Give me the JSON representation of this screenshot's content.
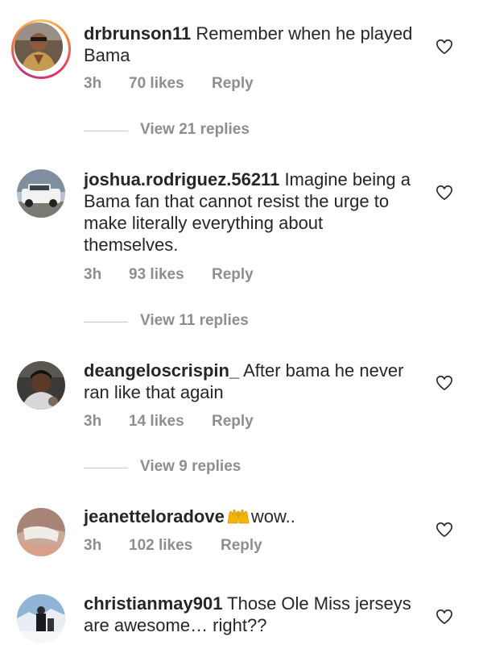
{
  "comments": [
    {
      "username": "drbrunson11",
      "text": "Remember when he played Bama",
      "time": "3h",
      "likes": "70 likes",
      "reply_label": "Reply",
      "view_replies": "View 21 replies"
    },
    {
      "username": "joshua.rodriguez.56211",
      "text": "Imagine being a Bama fan that cannot resist the urge to make literally everything about themselves.",
      "time": "3h",
      "likes": "93 likes",
      "reply_label": "Reply",
      "view_replies": "View 11 replies"
    },
    {
      "username": "deangeloscrispin_",
      "text": "After bama he never ran like that again",
      "time": "3h",
      "likes": "14 likes",
      "reply_label": "Reply",
      "view_replies": "View 9 replies"
    },
    {
      "username": "jeanetteloradove",
      "emoji": "raising-hands-emoji",
      "text": "wow..",
      "time": "3h",
      "likes": "102 likes",
      "reply_label": "Reply"
    },
    {
      "username": "christianmay901",
      "text": "Those Ole Miss jerseys are awesome… right??"
    }
  ],
  "icons": {
    "like": "heart-outline-icon"
  },
  "colors": {
    "text": "#262626",
    "secondary": "#8e8e8e",
    "story_ring": "#e1306c"
  }
}
